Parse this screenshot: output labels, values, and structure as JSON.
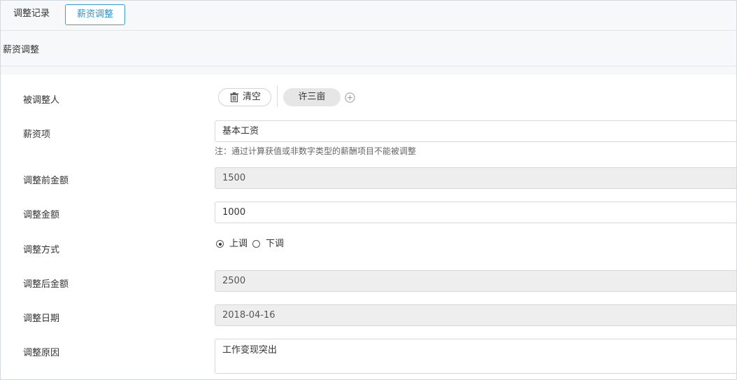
{
  "tabs": {
    "records_label": "调整记录",
    "salary_adjust_label": "薪资调整"
  },
  "section": {
    "title": "薪资调整"
  },
  "form": {
    "adjusted_person": {
      "label": "被调整人",
      "clear_label": "清空",
      "selected_person": "许三亩"
    },
    "salary_item": {
      "label": "薪资项",
      "value": "基本工资",
      "hint": "注：通过计算获值或非数字类型的薪酬项目不能被调整"
    },
    "amount_before": {
      "label": "调整前金额",
      "value": "1500"
    },
    "adjust_amount": {
      "label": "调整金额",
      "value": "1000"
    },
    "adjust_method": {
      "label": "调整方式",
      "options": [
        "上调",
        "下调"
      ],
      "selected": "上调"
    },
    "amount_after": {
      "label": "调整后金额",
      "value": "2500"
    },
    "adjust_date": {
      "label": "调整日期",
      "value": "2018-04-16"
    },
    "adjust_reason": {
      "label": "调整原因",
      "value": "工作变现突出"
    }
  },
  "colors": {
    "accent": "#2f95cc",
    "header_bg": "#f7f8fa",
    "readonly_bg": "#eeeeee",
    "tag_bg": "#e6e6e6"
  }
}
